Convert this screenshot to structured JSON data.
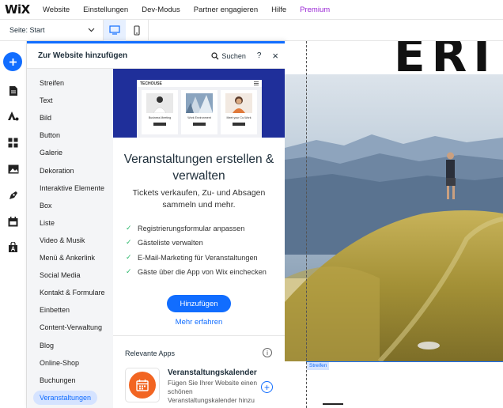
{
  "topbar": {
    "logo": "WiX",
    "menu": [
      "Website",
      "Einstellungen",
      "Dev-Modus",
      "Partner engagieren",
      "Hilfe",
      "Premium"
    ]
  },
  "subbar": {
    "page_label": "Seite: Start"
  },
  "panel": {
    "title": "Zur Website hinzufügen",
    "search_label": "Suchen",
    "help_label": "?",
    "close_label": "×",
    "categories": [
      "Streifen",
      "Text",
      "Bild",
      "Button",
      "Galerie",
      "Dekoration",
      "Interaktive Elemente",
      "Box",
      "Liste",
      "Video & Musik",
      "Menü & Ankerlink",
      "Social Media",
      "Kontakt & Formulare",
      "Einbetten",
      "Content-Verwaltung",
      "Blog",
      "Online-Shop",
      "Buchungen",
      "Veranstaltungen"
    ],
    "active_category": "Veranstaltungen"
  },
  "hero": {
    "brand": "TECHOUSE",
    "cards": [
      "Business Meeting",
      "Work Environment",
      "Meet your Co-Work"
    ]
  },
  "content": {
    "headline": "Veranstaltungen erstellen & verwalten",
    "subhead": "Tickets verkaufen, Zu- und Absagen sammeln und mehr.",
    "features": [
      "Registrierungsformular anpassen",
      "Gästeliste verwalten",
      "E-Mail-Marketing für Veranstaltungen",
      "Gäste über die App von Wix einchecken"
    ],
    "add_button": "Hinzufügen",
    "more_link": "Mehr erfahren",
    "apps_title": "Relevante Apps",
    "info_glyph": "i",
    "app": {
      "name": "Veranstaltungskalender",
      "description": "Fügen Sie Ihrer Website einen schönen Veranstaltungskalender hinzu",
      "add_glyph": "+"
    }
  },
  "canvas": {
    "strip_label": "Streifen",
    "hero_text": "ERI"
  },
  "colors": {
    "accent": "#116dff",
    "premium": "#9a27d5",
    "check": "#2bb86b",
    "hero_bg": "#1f2f9a",
    "app_icon": "#f26522"
  }
}
